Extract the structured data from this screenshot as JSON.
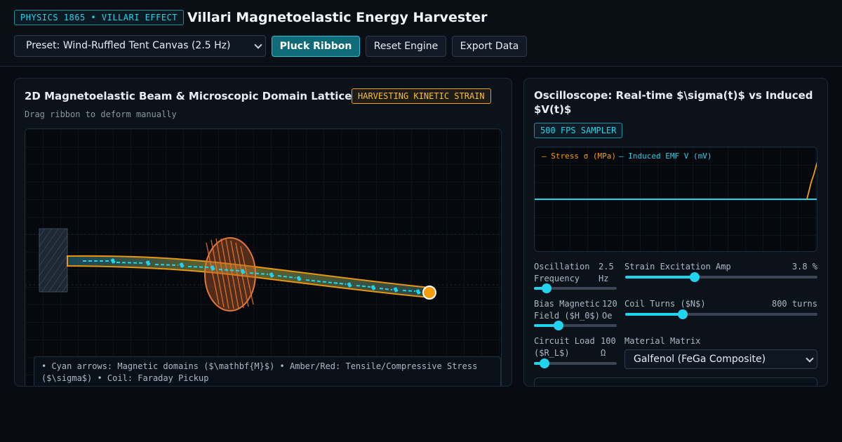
{
  "header": {
    "tag": "PHYSICS 1865 • VILLARI EFFECT",
    "title": "Villari Magnetoelastic Energy Harvester",
    "preset_value": "Preset: Wind-Ruffled Tent Canvas (2.5 Hz)",
    "pluck_label": "Pluck Ribbon",
    "reset_label": "Reset Engine",
    "export_label": "Export Data"
  },
  "beam_panel": {
    "title": "2D Magnetoelastic Beam & Microscopic Domain Lattice",
    "badge": "HARVESTING KINETIC STRAIN",
    "hint": "Drag ribbon to deform manually",
    "legend_line1": "• Cyan arrows: Magnetic domains ($\\mathbf{M}$)  • Amber/Red: Tensile/Compressive Stress",
    "legend_line2": "($\\sigma$)  • Coil: Faraday Pickup"
  },
  "scope_panel": {
    "title_line1": "Oscilloscope: Real-time $\\sigma(t)$ vs Induced",
    "title_line2": "$V(t)$",
    "badge": "500 FPS SAMPLER",
    "legend_stress": "— Stress σ (MPa)",
    "legend_emf": "— Induced EMF V (mV)"
  },
  "controls": {
    "freq": {
      "label1": "Oscillation",
      "label2": "Frequency",
      "val1": "2.5",
      "val2": "Hz",
      "fraction": 0.15
    },
    "strain": {
      "label": "Strain Excitation Amp",
      "val": "3.8 %",
      "fraction": 0.36
    },
    "bias": {
      "label1": "Bias Magnetic",
      "label2": "Field ($H_0$)",
      "val1": "120",
      "val2": "Oe",
      "fraction": 0.3
    },
    "turns": {
      "label": "Coil Turns ($N$)",
      "val": "800 turns",
      "fraction": 0.3
    },
    "load": {
      "label1": "Circuit Load",
      "label2": "($R_L$)",
      "val1": "100",
      "val2": "Ω",
      "fraction": 0.13
    },
    "material": {
      "label": "Material Matrix",
      "value": "Galfenol (FeGa Composite)"
    }
  },
  "colors": {
    "accent_cyan": "#22d3ee",
    "stress_amber": "#f59e0b",
    "background": "#080c12"
  }
}
